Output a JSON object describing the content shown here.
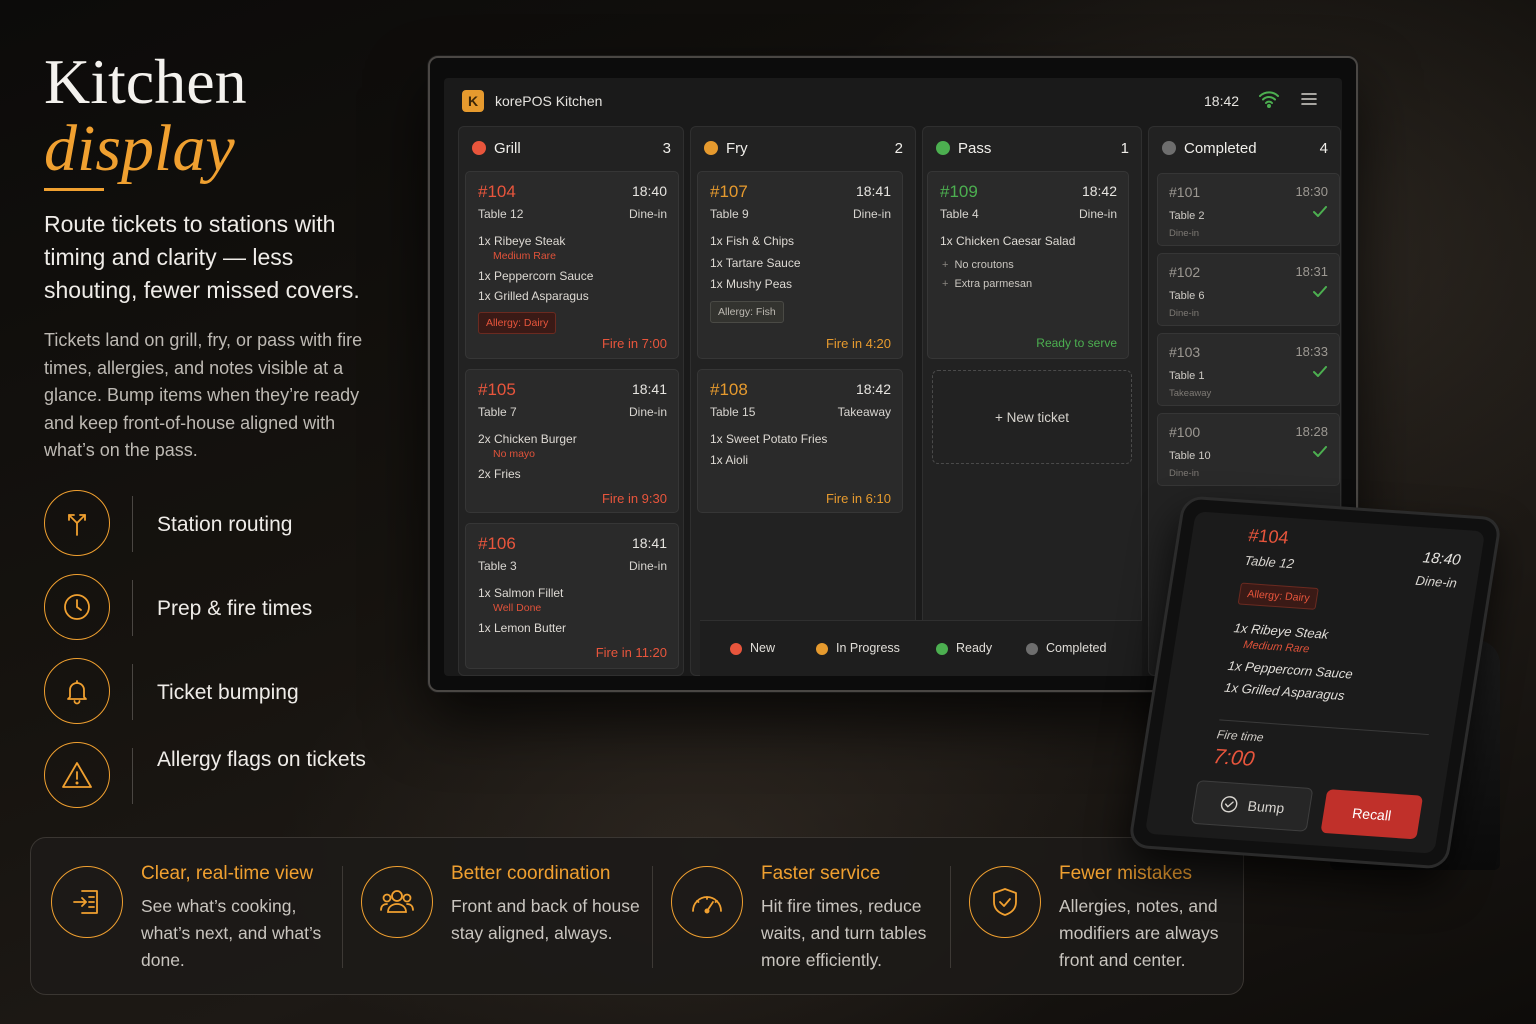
{
  "hero": {
    "title": "Kitchen",
    "title_accent": "display",
    "lead": "Route tickets to stations with timing and clarity — less shouting, fewer missed covers.",
    "sub": "Tickets land on grill, fry, or pass with fire times, allergies, and notes visible at a glance. Bump items when they’re ready and keep front-of-house aligned with what’s on the pass."
  },
  "features": [
    {
      "icon": "route-split-icon",
      "label": "Station routing"
    },
    {
      "icon": "clock-icon",
      "label": "Prep & fire times"
    },
    {
      "icon": "bell-icon",
      "label": "Ticket bumping"
    },
    {
      "icon": "warning-triangle-icon",
      "label": "Allergy flags on tickets"
    }
  ],
  "benefits": [
    {
      "icon": "list-import-icon",
      "title": "Clear, real-time view",
      "text": "See what’s cooking, what’s next, and what’s done."
    },
    {
      "icon": "team-icon",
      "title": "Better coordination",
      "text": "Front and back of house stay aligned, always."
    },
    {
      "icon": "speedometer-icon",
      "title": "Faster service",
      "text": "Hit fire times, reduce waits, and turn tables more efficiently."
    },
    {
      "icon": "shield-check-icon",
      "title": "Fewer mistakes",
      "text": "Allergies, notes, and modifiers are always front and center."
    }
  ],
  "app": {
    "logo": "K",
    "title": "korePOS Kitchen",
    "time": "18:42"
  },
  "colors": {
    "accent": "#f0a030",
    "new": "#e8553c",
    "in_progress": "#e69a2e",
    "ready": "#4caf50",
    "completed": "#6e6e6e"
  },
  "columns": {
    "grill": {
      "name": "Grill",
      "count": "3"
    },
    "fry": {
      "name": "Fry",
      "count": "2"
    },
    "pass": {
      "name": "Pass",
      "count": "1"
    },
    "completed": {
      "name": "Completed",
      "count": "4"
    }
  },
  "tickets": {
    "t104": {
      "id": "#104",
      "time": "18:40",
      "table": "Table 12",
      "type": "Dine-in",
      "items": [
        "1x Ribeye Steak",
        "1x Peppercorn Sauce",
        "1x Grilled Asparagus"
      ],
      "mod": "Medium Rare",
      "tag": "Allergy: Dairy",
      "fire": "Fire in 7:00"
    },
    "t105": {
      "id": "#105",
      "time": "18:41",
      "table": "Table 7",
      "type": "Dine-in",
      "items": [
        "2x Chicken Burger",
        "2x Fries"
      ],
      "mod": "No mayo",
      "fire": "Fire in 9:30"
    },
    "t106": {
      "id": "#106",
      "time": "18:41",
      "table": "Table 3",
      "type": "Dine-in",
      "items": [
        "1x Salmon Fillet",
        "1x Lemon Butter"
      ],
      "mod": "Well Done",
      "fire": "Fire in 11:20"
    },
    "t107": {
      "id": "#107",
      "time": "18:41",
      "table": "Table 9",
      "type": "Dine-in",
      "items": [
        "1x Fish & Chips",
        "1x Tartare Sauce",
        "1x Mushy Peas"
      ],
      "tag": "Allergy: Fish",
      "fire": "Fire in 4:20"
    },
    "t108": {
      "id": "#108",
      "time": "18:42",
      "table": "Table 15",
      "type": "Takeaway",
      "items": [
        "1x Sweet Potato Fries",
        "1x Aioli"
      ],
      "fire": "Fire in 6:10"
    },
    "t109": {
      "id": "#109",
      "time": "18:42",
      "table": "Table 4",
      "type": "Dine-in",
      "items": [
        "1x Chicken Caesar Salad"
      ],
      "options": [
        "No croutons",
        "Extra parmesan"
      ],
      "status": "Ready to serve"
    }
  },
  "new_ticket": "+ New ticket",
  "completed": [
    {
      "id": "#101",
      "time": "18:30",
      "table": "Table 2",
      "type": "Dine-in"
    },
    {
      "id": "#102",
      "time": "18:31",
      "table": "Table 6",
      "type": "Dine-in"
    },
    {
      "id": "#103",
      "time": "18:33",
      "table": "Table 1",
      "type": "Takeaway"
    },
    {
      "id": "#100",
      "time": "18:28",
      "table": "Table 10",
      "type": "Dine-in"
    }
  ],
  "legend": [
    "New",
    "In Progress",
    "Ready",
    "Completed"
  ],
  "tablet": {
    "id": "#104",
    "table": "Table 12",
    "time": "18:40",
    "type": "Dine-in",
    "tag": "Allergy: Dairy",
    "items": [
      "1x Ribeye Steak",
      "1x Peppercorn Sauce",
      "1x Grilled Asparagus"
    ],
    "mod": "Medium Rare",
    "fire_label": "Fire time",
    "fire_value": "7:00",
    "bump": "Bump",
    "recall": "Recall"
  }
}
